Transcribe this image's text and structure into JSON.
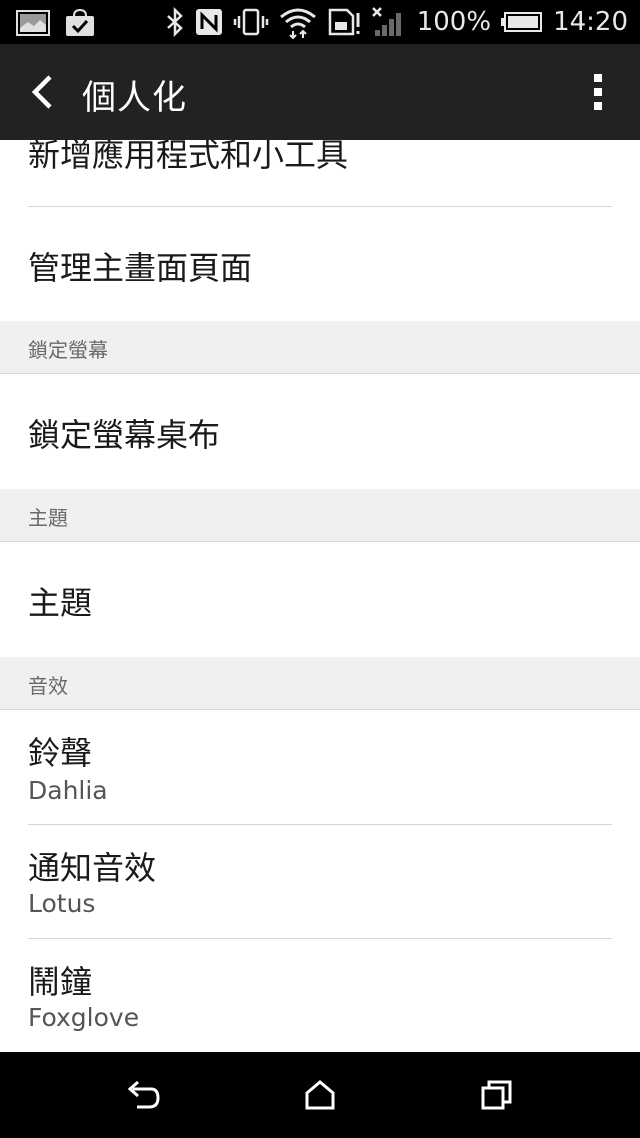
{
  "status_bar": {
    "battery_percent": "100%",
    "time": "14:20",
    "icons": [
      "image-notification-icon",
      "bag-check-icon",
      "bluetooth-icon",
      "nfc-icon",
      "vibrate-icon",
      "wifi-icon",
      "sd-card-alert-icon",
      "no-signal-icon",
      "battery-icon"
    ]
  },
  "action_bar": {
    "title": "個人化"
  },
  "list": {
    "item_add_apps": "新增應用程式和小工具",
    "item_manage_home": "管理主畫面頁面",
    "section_lockscreen": "鎖定螢幕",
    "item_lockscreen_wallpaper": "鎖定螢幕桌布",
    "section_theme": "主題",
    "item_theme": "主題",
    "section_sound": "音效",
    "item_ringtone": "鈴聲",
    "item_ringtone_value": "Dahlia",
    "item_notification": "通知音效",
    "item_notification_value": "Lotus",
    "item_alarm": "鬧鐘",
    "item_alarm_value": "Foxglove"
  },
  "nav_bar": {
    "icons": [
      "back-icon",
      "home-icon",
      "recents-icon"
    ]
  },
  "colors": {
    "status_bar": "#000000",
    "action_bar": "#222222",
    "section_header": "#eff0f0",
    "nav_bar": "#000000"
  }
}
